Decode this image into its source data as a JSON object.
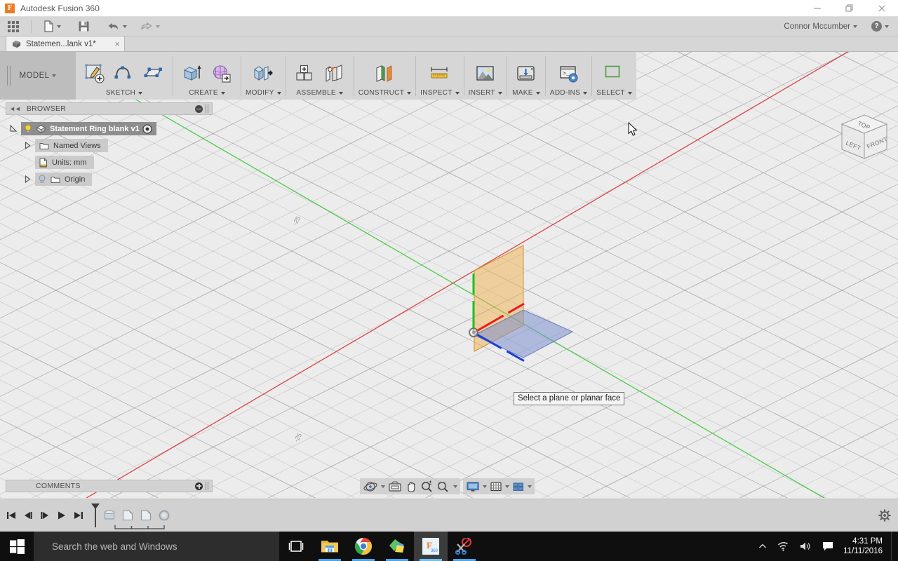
{
  "titlebar": {
    "app_name": "Autodesk Fusion 360",
    "logo_letter": "F",
    "minimize_label": "Minimize",
    "restore_label": "Restore",
    "close_label": "Close"
  },
  "quick_access": {
    "app_grid_label": "Show Data Panel",
    "new_label": "New Design",
    "save_label": "Save",
    "undo_label": "Undo",
    "redo_label": "Redo",
    "user_name": "Connor Mccumber",
    "help_label": "?"
  },
  "document_tab": {
    "title": "Statemen...lank v1*",
    "close_label": "×"
  },
  "workspace": {
    "label": "MODEL"
  },
  "ribbon": {
    "panels": [
      {
        "label": "SKETCH",
        "has_caret": true,
        "buttons": [
          {
            "name": "create-sketch-button",
            "icon": "create-sketch-icon",
            "label": "Create Sketch"
          },
          {
            "name": "spline-button",
            "icon": "spline-icon",
            "label": "Spline"
          },
          {
            "name": "rectangle-button",
            "icon": "rectangle-icon",
            "label": "Rectangle"
          }
        ]
      },
      {
        "label": "CREATE",
        "has_caret": true,
        "buttons": [
          {
            "name": "extrude-button",
            "icon": "extrude-icon",
            "label": "Extrude"
          },
          {
            "name": "create-form-button",
            "icon": "create-form-icon",
            "label": "Create Form"
          }
        ]
      },
      {
        "label": "MODIFY",
        "has_caret": true,
        "buttons": [
          {
            "name": "press-pull-button",
            "icon": "press-pull-icon",
            "label": "Press Pull"
          }
        ]
      },
      {
        "label": "ASSEMBLE",
        "has_caret": true,
        "buttons": [
          {
            "name": "new-component-button",
            "icon": "new-component-icon",
            "label": "New Component"
          },
          {
            "name": "joint-button",
            "icon": "joint-icon",
            "label": "Joint"
          }
        ]
      },
      {
        "label": "CONSTRUCT",
        "has_caret": true,
        "buttons": [
          {
            "name": "offset-plane-button",
            "icon": "offset-plane-icon",
            "label": "Offset Plane"
          }
        ]
      },
      {
        "label": "INSPECT",
        "has_caret": true,
        "buttons": [
          {
            "name": "measure-button",
            "icon": "ruler-icon",
            "label": "Measure"
          }
        ]
      },
      {
        "label": "INSERT",
        "has_caret": true,
        "buttons": [
          {
            "name": "insert-image-button",
            "icon": "image-icon",
            "label": "Insert Image"
          }
        ]
      },
      {
        "label": "MAKE",
        "has_caret": true,
        "buttons": [
          {
            "name": "3d-print-button",
            "icon": "printer-icon",
            "label": "3D Print"
          }
        ]
      },
      {
        "label": "ADD-INS",
        "has_caret": true,
        "buttons": [
          {
            "name": "scripts-addins-button",
            "icon": "console-gear-icon",
            "label": "Scripts and Add-Ins"
          }
        ]
      },
      {
        "label": "SELECT",
        "has_caret": true,
        "buttons": [
          {
            "name": "select-button",
            "icon": "select-window-icon",
            "label": "Select"
          }
        ]
      }
    ]
  },
  "browser": {
    "header": "BROWSER",
    "tree": [
      {
        "label": "Statement Ring blank v1",
        "type": "root",
        "selected": true,
        "indent": 0
      },
      {
        "label": "Named Views",
        "type": "folder",
        "selected": false,
        "indent": 1
      },
      {
        "label": "Units: mm",
        "type": "units",
        "selected": false,
        "indent": 1
      },
      {
        "label": "Origin",
        "type": "origin-folder",
        "selected": false,
        "indent": 1
      }
    ]
  },
  "comments": {
    "header": "COMMENTS"
  },
  "viewport": {
    "tooltip": "Select a plane or planar face",
    "axis_label_top": "-25",
    "axis_label_bottom": "-25",
    "colors": {
      "x_axis": "#d8262c",
      "y_axis": "#2fc62f",
      "z_axis": "#1a3fd8",
      "xz_plane": "#f0ab3c",
      "xy_plane": "#7b8fd0",
      "grid": "#8c8c8c",
      "background": "#ececec"
    }
  },
  "viewcube": {
    "face_top": "TOP",
    "face_left": "LEFT",
    "face_front": "FRONT"
  },
  "navbar": {
    "orbit_label": "Orbit",
    "look_at_label": "Look At",
    "pan_label": "Pan",
    "zoom_label": "Zoom",
    "fit_label": "Fit",
    "display_settings_label": "Display Settings",
    "grid_snaps_label": "Grid and Snaps",
    "viewports_label": "Viewports"
  },
  "timeline": {
    "go_to_beginning_label": "Go to Beginning",
    "step_back_label": "Step Back",
    "step_forward_label": "Step Forward",
    "play_label": "Play",
    "go_to_end_label": "Go to End",
    "features": [
      {
        "name": "timeline-feature-1",
        "icon": "cylinder-icon"
      },
      {
        "name": "timeline-feature-2",
        "icon": "sketch-icon"
      },
      {
        "name": "timeline-feature-3",
        "icon": "sketch-icon"
      },
      {
        "name": "timeline-feature-4",
        "icon": "circle-icon"
      }
    ],
    "settings_label": "Timeline Settings"
  },
  "taskbar": {
    "start_label": "Start",
    "search_placeholder": "Search the web and Windows",
    "task_view_label": "Task View",
    "apps": [
      {
        "name": "taskbar-file-explorer",
        "label": "File Explorer",
        "running": true,
        "active": false
      },
      {
        "name": "taskbar-chrome",
        "label": "Google Chrome",
        "running": true,
        "active": false
      },
      {
        "name": "taskbar-sticky-notes",
        "label": "Sticky Notes",
        "running": true,
        "active": false
      },
      {
        "name": "taskbar-fusion360",
        "label": "Autodesk Fusion 360",
        "running": true,
        "active": true
      },
      {
        "name": "taskbar-snipping-tool",
        "label": "Snipping Tool",
        "running": true,
        "active": false
      }
    ],
    "tray": {
      "show_hidden_label": "Show hidden icons",
      "network_label": "Network",
      "volume_label": "Volume",
      "action_center_label": "Action Center",
      "time": "4:31 PM",
      "date": "11/11/2016"
    }
  }
}
